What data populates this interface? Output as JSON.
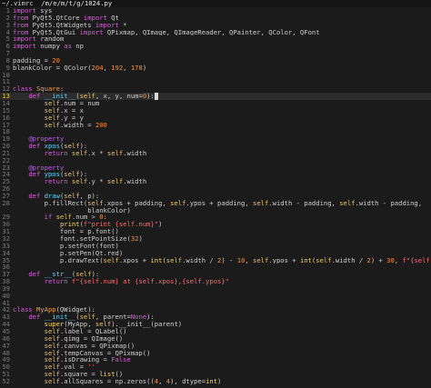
{
  "tabline": {
    "prefix": "~/.vimrc",
    "path": "/m/e/m/t/g/1024.py"
  },
  "cursor_line": 13,
  "lines": [
    {
      "n": 1,
      "t": "import sys"
    },
    {
      "n": 2,
      "t": "from PyQt5.QtCore import Qt"
    },
    {
      "n": 3,
      "t": "from PyQt5.QtWidgets import *"
    },
    {
      "n": 4,
      "t": "from PyQt5.QtGui import QPixmap, QImage, QImageReader, QPainter, QColor, QFont"
    },
    {
      "n": 5,
      "t": "import random"
    },
    {
      "n": 6,
      "t": "import numpy as np"
    },
    {
      "n": 7,
      "t": ""
    },
    {
      "n": 8,
      "t": "padding = 20"
    },
    {
      "n": 9,
      "t": "blankColor = QColor(204, 192, 178)"
    },
    {
      "n": 10,
      "t": ""
    },
    {
      "n": 11,
      "t": ""
    },
    {
      "n": 12,
      "t": "class Square:"
    },
    {
      "n": 13,
      "t": "    def __init__(self, x, y, num=0):"
    },
    {
      "n": 14,
      "t": "        self.num = num"
    },
    {
      "n": 15,
      "t": "        self.x = x"
    },
    {
      "n": 16,
      "t": "        self.y = y"
    },
    {
      "n": 17,
      "t": "        self.width = 200"
    },
    {
      "n": 18,
      "t": ""
    },
    {
      "n": 19,
      "t": "    @property"
    },
    {
      "n": 20,
      "t": "    def xpos(self):"
    },
    {
      "n": 21,
      "t": "        return self.x * self.width"
    },
    {
      "n": 22,
      "t": ""
    },
    {
      "n": 23,
      "t": "    @property"
    },
    {
      "n": 24,
      "t": "    def ypos(self):"
    },
    {
      "n": 25,
      "t": "        return self.y * self.width"
    },
    {
      "n": 26,
      "t": ""
    },
    {
      "n": 27,
      "t": "    def draw(self, p):"
    },
    {
      "n": 28,
      "t": "        p.fillRect(self.xpos + padding, self.ypos + padding, self.width - padding, self.width - padding,"
    },
    {
      "n": "",
      "t": "                   blankColor)"
    },
    {
      "n": 29,
      "t": "        if self.num > 0:"
    },
    {
      "n": 30,
      "t": "            print(f\"print {self.num}\")"
    },
    {
      "n": 31,
      "t": "            font = p.font()"
    },
    {
      "n": 32,
      "t": "            font.setPointSize(32)"
    },
    {
      "n": 33,
      "t": "            p.setFont(font)"
    },
    {
      "n": 34,
      "t": "            p.setPen(Qt.red)"
    },
    {
      "n": 35,
      "t": "            p.drawText(self.xpos + int(self.width / 2) - 10, self.ypos + int(self.width / 2) + 30, f\"{self.num}\")"
    },
    {
      "n": 36,
      "t": ""
    },
    {
      "n": 37,
      "t": "    def __str__(self):"
    },
    {
      "n": 38,
      "t": "        return f\"{self.num} at {self.xpos},{self.ypos}\""
    },
    {
      "n": 39,
      "t": ""
    },
    {
      "n": 40,
      "t": ""
    },
    {
      "n": 41,
      "t": ""
    },
    {
      "n": 42,
      "t": "class MyApp(QWidget):"
    },
    {
      "n": 43,
      "t": "    def __init__(self, parent=None):"
    },
    {
      "n": 44,
      "t": "        super(MyApp, self).__init__(parent)"
    },
    {
      "n": 45,
      "t": "        self.label = QLabel()"
    },
    {
      "n": 46,
      "t": "        self.qimg = QImage()"
    },
    {
      "n": 47,
      "t": "        self.canvas = QPixmap()"
    },
    {
      "n": 48,
      "t": "        self.tempCanvas = QPixmap()"
    },
    {
      "n": 49,
      "t": "        self.isDrawing = False"
    },
    {
      "n": 50,
      "t": "        self.val = ''"
    },
    {
      "n": 51,
      "t": "        self.square = list()"
    },
    {
      "n": 52,
      "t": "        self.allSquares = np.zeros((4, 4), dtype=int)"
    }
  ]
}
